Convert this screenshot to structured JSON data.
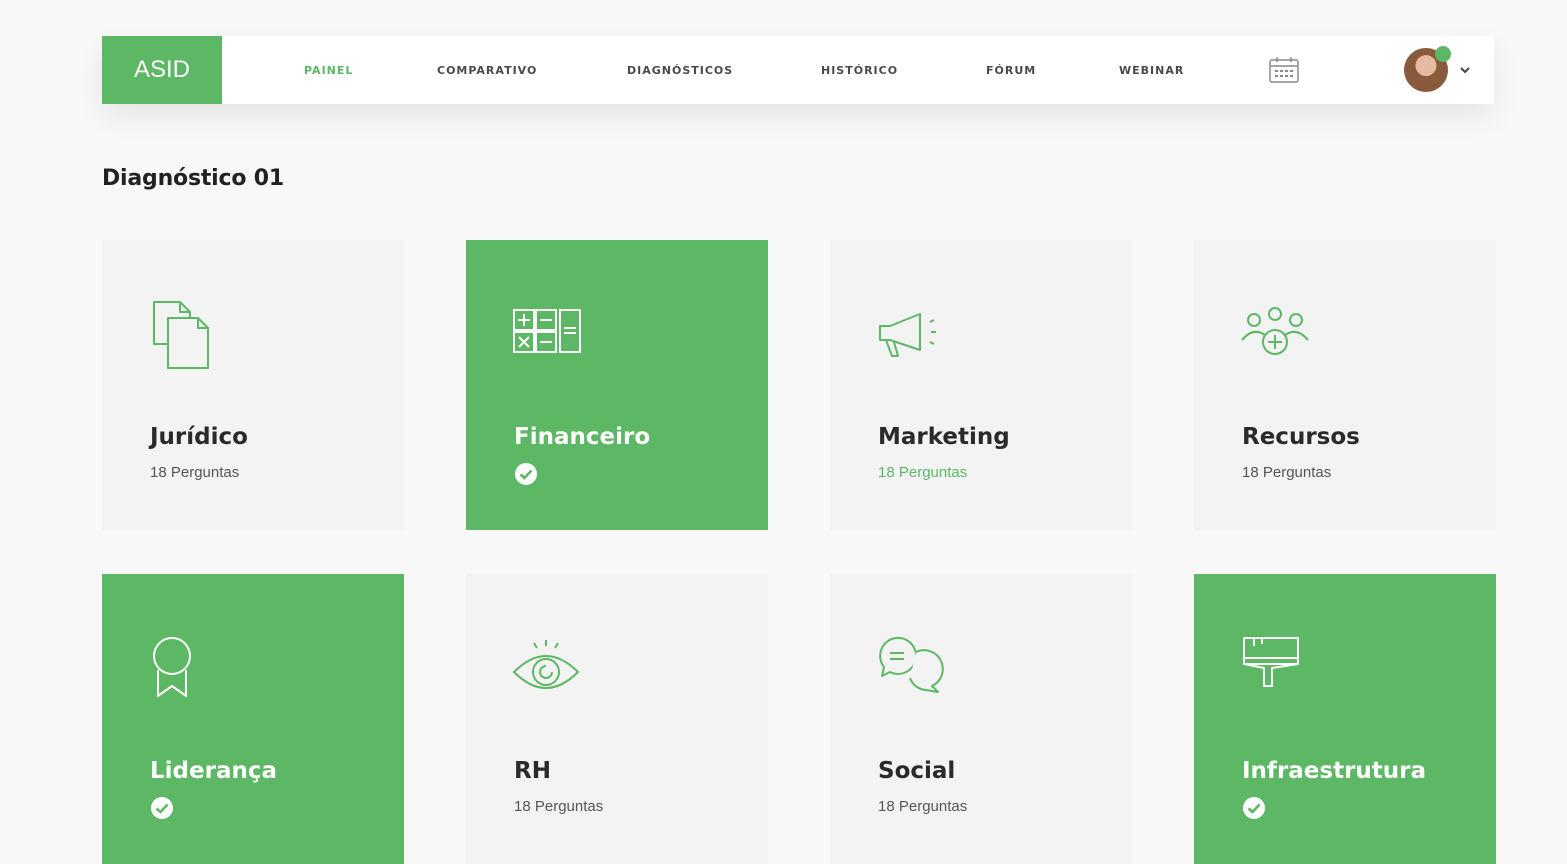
{
  "brand": {
    "logo": "ASID"
  },
  "nav": {
    "items": [
      {
        "label": "PAINEL",
        "active": true
      },
      {
        "label": "COMPARATIVO"
      },
      {
        "label": "DIAGNÓSTICOS"
      },
      {
        "label": "HISTÓRICO"
      },
      {
        "label": "FÓRUM"
      },
      {
        "label": "WEBINAR"
      }
    ],
    "calendar_icon": "calendar-icon",
    "avatar_icon": "user-avatar"
  },
  "page": {
    "title": "Diagnóstico 01"
  },
  "cards": [
    {
      "title": "Jurídico",
      "subtitle": "18 Perguntas",
      "completed": false,
      "icon": "documents-icon"
    },
    {
      "title": "Financeiro",
      "subtitle": "",
      "completed": true,
      "icon": "calculator-icon"
    },
    {
      "title": "Marketing",
      "subtitle": "18 Perguntas",
      "completed": false,
      "highlight": true,
      "icon": "megaphone-icon"
    },
    {
      "title": "Recursos",
      "subtitle": "18 Perguntas",
      "completed": false,
      "icon": "team-plus-icon"
    },
    {
      "title": "Liderança",
      "subtitle": "",
      "completed": true,
      "icon": "award-icon"
    },
    {
      "title": "RH",
      "subtitle": "18 Perguntas",
      "completed": false,
      "icon": "eye-icon"
    },
    {
      "title": "Social",
      "subtitle": "18 Perguntas",
      "completed": false,
      "icon": "chat-icon"
    },
    {
      "title": "Infraestrutura",
      "subtitle": "",
      "completed": true,
      "icon": "paint-brush-icon"
    }
  ],
  "colors": {
    "accent": "#5cb865",
    "background": "#f8f8f8",
    "card": "#f3f3f3"
  }
}
